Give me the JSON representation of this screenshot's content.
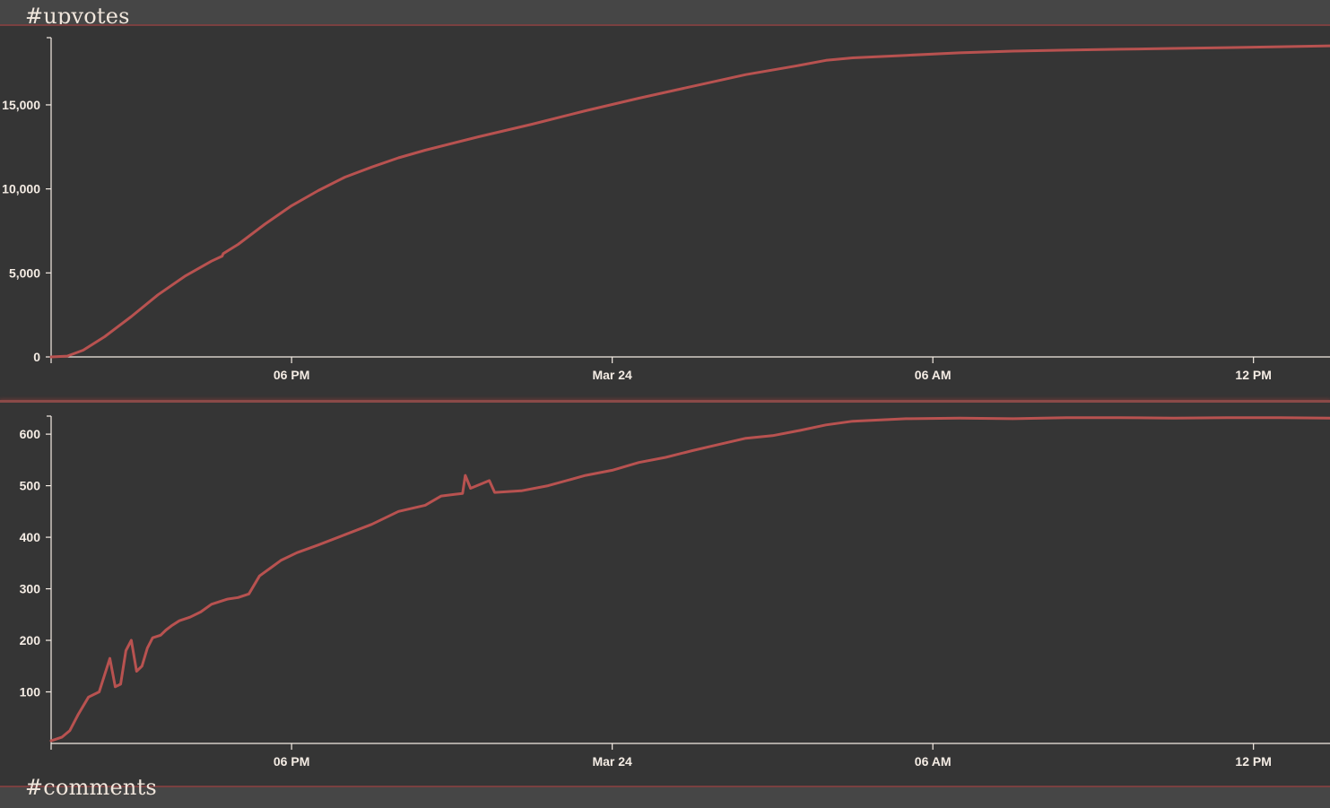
{
  "sections": {
    "upvotes_title": "#upvotes",
    "comments_title": "#comments"
  },
  "colors": {
    "background": "#464646",
    "panel": "#353535",
    "line": "#b85250",
    "axis": "#f4ece4"
  },
  "chart_data": [
    {
      "type": "line",
      "title": "#upvotes",
      "x_unit": "hours since first point (axis labels at 06 PM, Mar 24, 06 AM, 12 PM)",
      "x_ticks": [
        {
          "x": 4.5,
          "label": "06 PM"
        },
        {
          "x": 10.5,
          "label": "Mar 24"
        },
        {
          "x": 16.5,
          "label": "06 AM"
        },
        {
          "x": 22.5,
          "label": "12 PM"
        }
      ],
      "xlim": [
        0,
        24.1
      ],
      "ylim": [
        0,
        19000
      ],
      "y_ticks": [
        {
          "y": 0,
          "label": "0"
        },
        {
          "y": 5000,
          "label": "5,000"
        },
        {
          "y": 10000,
          "label": "10,000"
        },
        {
          "y": 15000,
          "label": "15,000"
        }
      ],
      "grid": false,
      "series": [
        {
          "x": [
            0,
            0.3,
            0.6,
            1.0,
            1.5,
            2.0,
            2.5,
            3.0,
            3.2,
            3.22,
            3.5,
            4.0,
            4.5,
            5.0,
            5.5,
            6.0,
            6.5,
            7.0,
            8.0,
            9.0,
            10.0,
            11.0,
            12.0,
            13.0,
            14.0,
            14.5,
            15.0,
            16.0,
            17.0,
            18.0,
            19.0,
            20.0,
            21.0,
            22.0,
            23.0,
            24.1
          ],
          "y": [
            0,
            50,
            400,
            1200,
            2400,
            3700,
            4800,
            5700,
            6000,
            6150,
            6700,
            7900,
            9000,
            9900,
            10700,
            11300,
            11850,
            12300,
            13100,
            13850,
            14650,
            15400,
            16100,
            16800,
            17350,
            17650,
            17800,
            17950,
            18100,
            18200,
            18260,
            18310,
            18360,
            18410,
            18460,
            18520
          ]
        }
      ]
    },
    {
      "type": "line",
      "title": "#comments",
      "x_ticks": [
        {
          "x": 4.5,
          "label": "06 PM"
        },
        {
          "x": 10.5,
          "label": "Mar 24"
        },
        {
          "x": 16.5,
          "label": "06 AM"
        },
        {
          "x": 22.5,
          "label": "12 PM"
        }
      ],
      "xlim": [
        0,
        24.1
      ],
      "ylim": [
        0,
        635
      ],
      "y_ticks": [
        {
          "y": 100,
          "label": "100"
        },
        {
          "y": 200,
          "label": "200"
        },
        {
          "y": 300,
          "label": "300"
        },
        {
          "y": 400,
          "label": "400"
        },
        {
          "y": 500,
          "label": "500"
        },
        {
          "y": 600,
          "label": "600"
        }
      ],
      "grid": false,
      "series": [
        {
          "x": [
            0,
            0.2,
            0.35,
            0.5,
            0.7,
            0.9,
            1.1,
            1.2,
            1.3,
            1.4,
            1.5,
            1.6,
            1.7,
            1.8,
            1.9,
            2.05,
            2.15,
            2.25,
            2.4,
            2.6,
            2.8,
            3.0,
            3.3,
            3.5,
            3.7,
            3.9,
            4.1,
            4.3,
            4.6,
            5.0,
            5.5,
            6.0,
            6.5,
            7.0,
            7.3,
            7.7,
            7.75,
            7.85,
            8.2,
            8.3,
            8.8,
            9.3,
            10.0,
            10.5,
            11.0,
            11.5,
            12.0,
            12.5,
            13.0,
            13.5,
            14.0,
            14.5,
            15.0,
            16.0,
            17.0,
            18.0,
            19.0,
            20.0,
            21.0,
            22.0,
            23.0,
            24.1
          ],
          "y": [
            5,
            12,
            25,
            55,
            90,
            100,
            165,
            110,
            115,
            180,
            200,
            140,
            150,
            185,
            205,
            210,
            220,
            228,
            238,
            245,
            255,
            270,
            280,
            283,
            290,
            325,
            340,
            355,
            370,
            385,
            405,
            425,
            450,
            462,
            480,
            485,
            520,
            495,
            510,
            487,
            490,
            500,
            520,
            530,
            545,
            555,
            568,
            580,
            592,
            597,
            607,
            618,
            625,
            630,
            631,
            630,
            632,
            632,
            631,
            632,
            632,
            631
          ]
        }
      ]
    }
  ]
}
